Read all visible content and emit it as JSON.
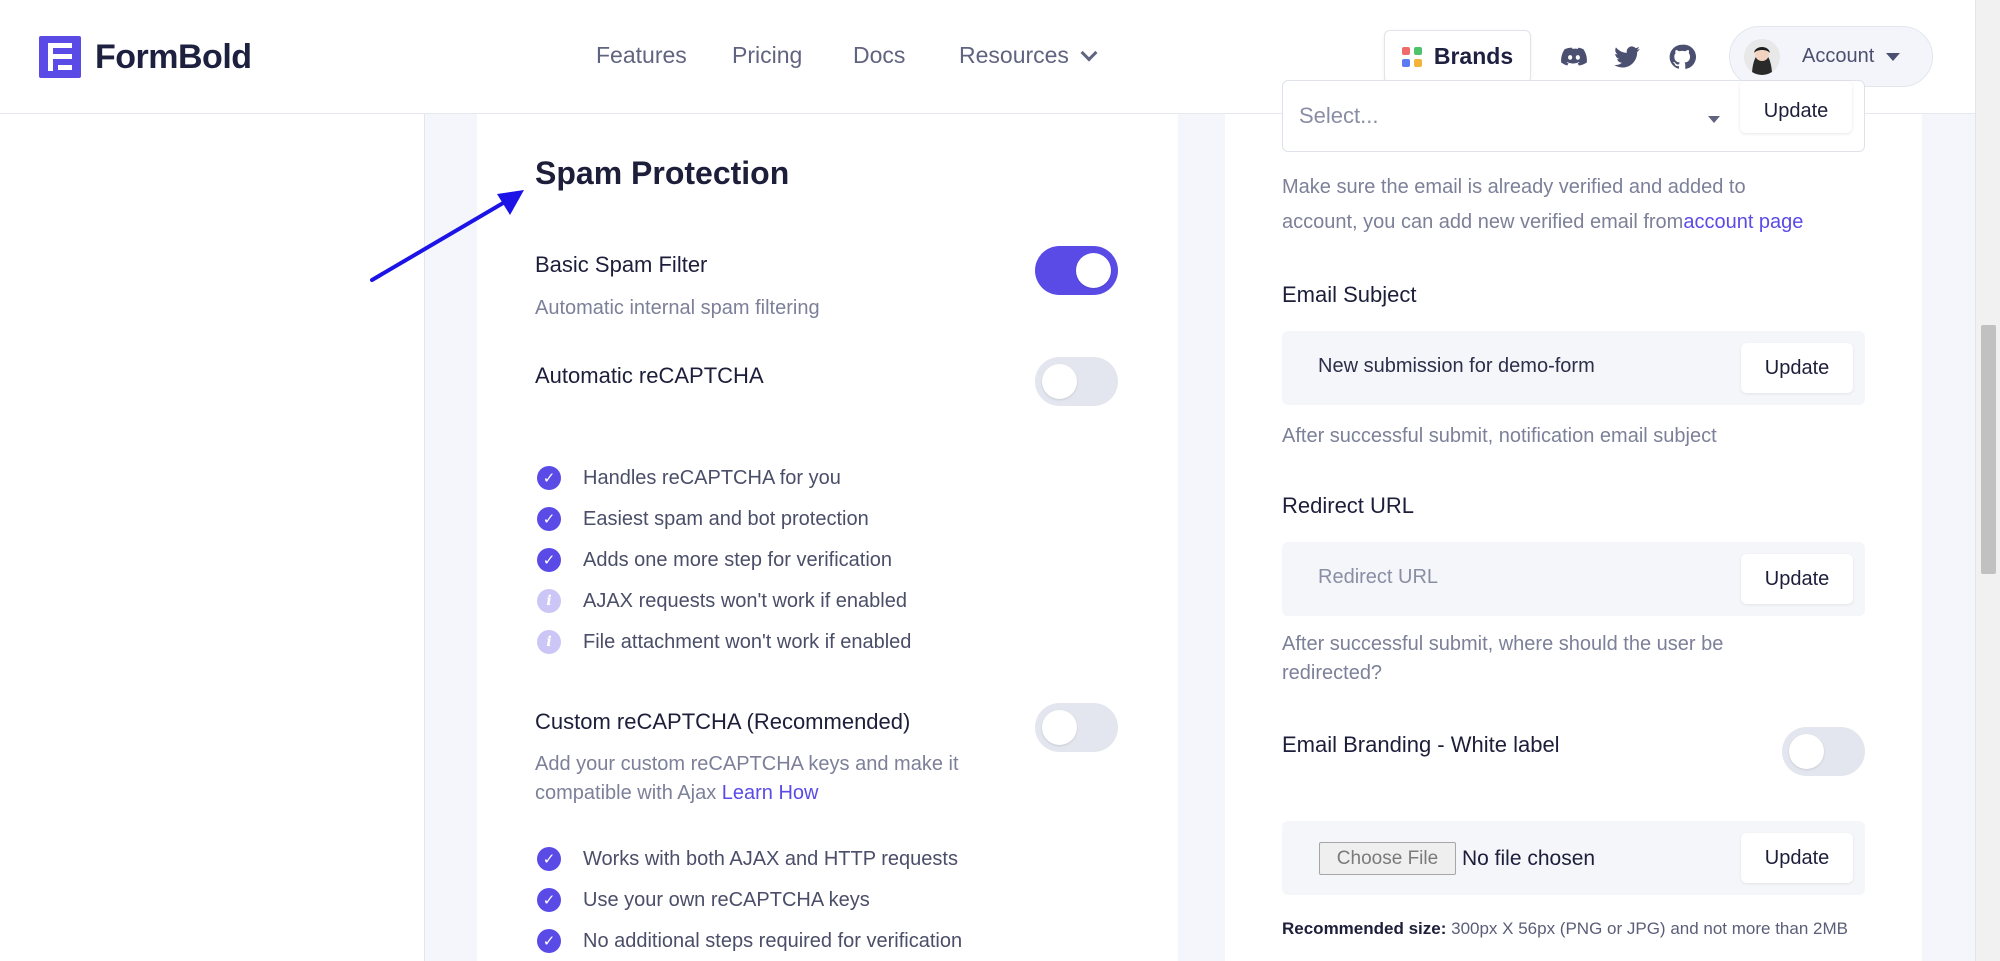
{
  "nav": {
    "logo_text": "FormBold",
    "links": [
      "Features",
      "Pricing",
      "Docs",
      "Resources"
    ],
    "brands_label": "Brands",
    "account_label": "Account",
    "social_icons": [
      "discord-icon",
      "twitter-icon",
      "github-icon"
    ]
  },
  "spam": {
    "heading": "Spam Protection",
    "basic": {
      "title": "Basic Spam Filter",
      "subtitle": "Automatic internal spam filtering",
      "enabled": true
    },
    "auto_recaptcha": {
      "title": "Automatic reCAPTCHA",
      "enabled": false,
      "features": [
        {
          "text": "Handles reCAPTCHA for you",
          "icon": "check-circle-icon"
        },
        {
          "text": "Easiest spam and bot protection",
          "icon": "check-circle-icon"
        },
        {
          "text": "Adds one more step for verification",
          "icon": "check-circle-icon"
        },
        {
          "text": "AJAX requests won't work if enabled",
          "icon": "info-circle-icon"
        },
        {
          "text": "File attachment won't work if enabled",
          "icon": "info-circle-icon"
        }
      ]
    },
    "custom_recaptcha": {
      "title": "Custom reCAPTCHA (Recommended)",
      "subtitle_line1": "Add your custom reCAPTCHA keys and make it",
      "subtitle_line2": "compatible with Ajax ",
      "link": "Learn How",
      "enabled": false,
      "features": [
        {
          "text": "Works with both AJAX and HTTP requests",
          "icon": "check-circle-icon"
        },
        {
          "text": "Use your own reCAPTCHA keys",
          "icon": "check-circle-icon"
        },
        {
          "text": "No additional steps required for verification",
          "icon": "check-circle-icon"
        }
      ]
    }
  },
  "settings": {
    "email_select": {
      "placeholder": "Select...",
      "button": "Update"
    },
    "email_help_line1": "Make sure the email is already verified and added to",
    "email_help_line2": "account, you can add new verified email from",
    "email_help_link": "account page",
    "subject": {
      "title": "Email Subject",
      "value": "New submission for demo-form",
      "button": "Update",
      "help": "After successful submit, notification email subject"
    },
    "redirect": {
      "title": "Redirect URL",
      "placeholder": "Redirect URL",
      "button": "Update",
      "help_line1": "After successful submit, where should the user be",
      "help_line2": "redirected?"
    },
    "branding": {
      "title": "Email Branding - White label",
      "enabled": false,
      "choose_file": "Choose File",
      "no_file": "No file chosen",
      "button": "Update",
      "rec_label": "Recommended size:",
      "rec_text": " 300px X 56px (PNG or JPG) and not more than 2MB"
    }
  },
  "colors": {
    "accent": "#5a4be7",
    "toggle_off": "#e3e6ee",
    "muted_text": "#7c8098"
  }
}
